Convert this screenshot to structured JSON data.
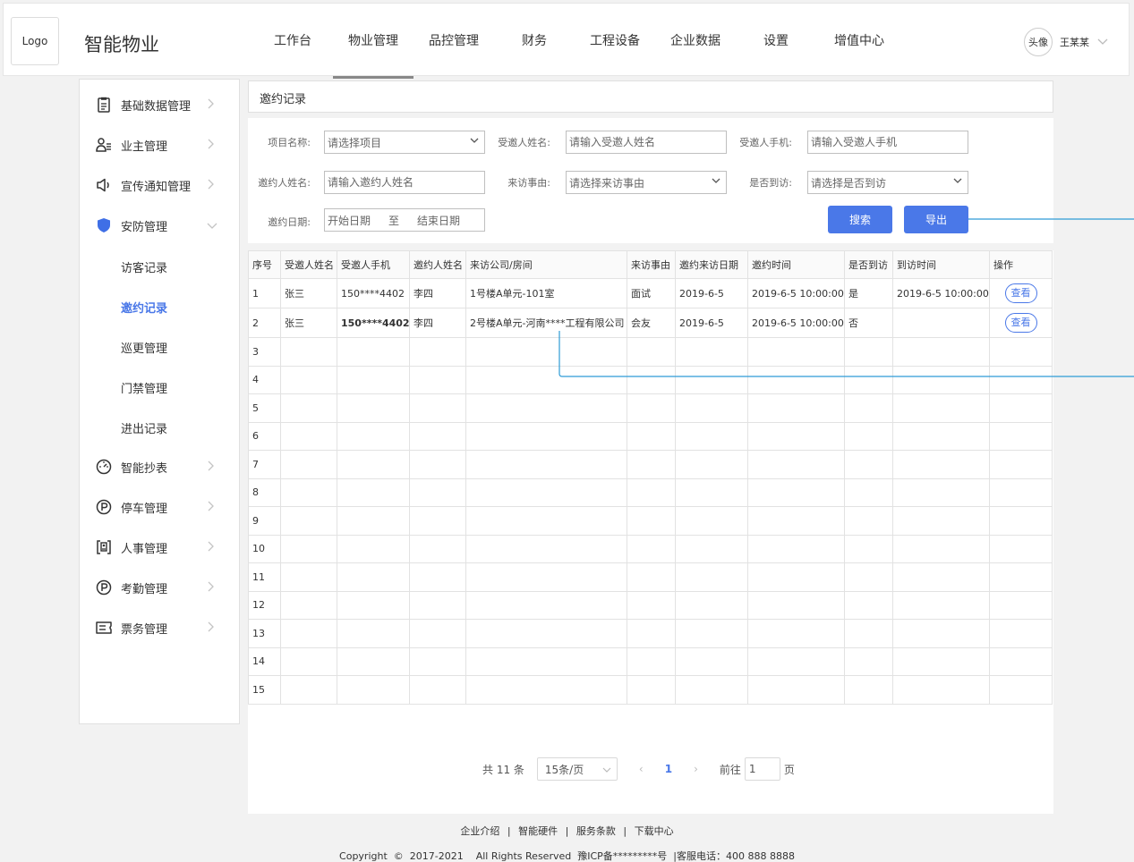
{
  "header": {
    "logo": "Logo",
    "title": "智能物业",
    "nav": [
      "工作台",
      "物业管理",
      "品控管理",
      "财务",
      "工程设备",
      "企业数据",
      "设置",
      "增值中心"
    ],
    "active_nav": "物业管理",
    "avatar": "头像",
    "username": "王某某"
  },
  "sidebar": {
    "items": [
      {
        "icon": "clipboard-icon",
        "label": "基础数据管理"
      },
      {
        "icon": "owner-icon",
        "label": "业主管理"
      },
      {
        "icon": "speaker-icon",
        "label": "宣传通知管理"
      },
      {
        "icon": "shield-icon",
        "label": "安防管理"
      },
      {
        "icon": "meter-icon",
        "label": "智能抄表"
      },
      {
        "icon": "parking-icon",
        "label": "停车管理"
      },
      {
        "icon": "hr-icon",
        "label": "人事管理"
      },
      {
        "icon": "attendance-icon",
        "label": "考勤管理"
      },
      {
        "icon": "ticket-icon",
        "label": "票务管理"
      }
    ],
    "sub_items": [
      "访客记录",
      "邀约记录",
      "巡更管理",
      "门禁管理",
      "进出记录"
    ],
    "active_sub": "邀约记录",
    "accent_color": "#4a78e8"
  },
  "breadcrumb": "邀约记录",
  "filters": {
    "project_label": "项目名称:",
    "project_placeholder": "请选择项目",
    "invitee_name_label": "受邀人姓名:",
    "invitee_name_placeholder": "请输入受邀人姓名",
    "invitee_phone_label": "受邀人手机:",
    "invitee_phone_placeholder": "请输入受邀人手机",
    "inviter_name_label": "邀约人姓名:",
    "inviter_name_placeholder": "请输入邀约人姓名",
    "reason_label": "来访事由:",
    "reason_placeholder": "请选择来访事由",
    "arrived_label": "是否到访:",
    "arrived_placeholder": "请选择是否到访",
    "date_label": "邀约日期:",
    "date_start": "开始日期",
    "date_to": "至",
    "date_end": "结束日期",
    "search_btn": "搜索",
    "export_btn": "导出"
  },
  "table": {
    "headers": [
      "序号",
      "受邀人姓名",
      "受邀人手机",
      "邀约人姓名",
      "来访公司/房间",
      "来访事由",
      "邀约来访日期",
      "邀约时间",
      "是否到访",
      "到访时间",
      "操作"
    ],
    "rows": [
      {
        "no": "1",
        "invitee": "张三",
        "phone": "150****4402",
        "inviter": "李四",
        "company": "1号楼A单元-101室",
        "reason": "面试",
        "visit_date": "2019-6-5",
        "invite_time": "2019-6-5 10:00:00",
        "arrived": "是",
        "arrive_time": "2019-6-5 10:00:00",
        "action": "查看"
      },
      {
        "no": "2",
        "invitee": "张三",
        "phone": "150****4402",
        "inviter": "李四",
        "company": "2号楼A单元-河南****工程有限公司",
        "reason": "会友",
        "visit_date": "2019-6-5",
        "invite_time": "2019-6-5 10:00:00",
        "arrived": "否",
        "arrive_time": "",
        "action": "查看"
      }
    ],
    "empty_rows": [
      "3",
      "4",
      "5",
      "6",
      "7",
      "8",
      "9",
      "10",
      "11",
      "12",
      "13",
      "14",
      "15"
    ]
  },
  "pagination": {
    "total": "共 11 条",
    "page_size": "15条/页",
    "prev": "‹",
    "current": "1",
    "next": "›",
    "goto_label": "前往",
    "goto_value": "1",
    "page_suffix": "页"
  },
  "footer": {
    "links": [
      "企业介绍",
      "智能硬件",
      "服务条款",
      "下载中心"
    ],
    "separator": "|",
    "copyright": "Copyright  ©  2017-2021    All Rights Reserved  豫ICP备*********号  |客服电话：400 888 8888"
  }
}
